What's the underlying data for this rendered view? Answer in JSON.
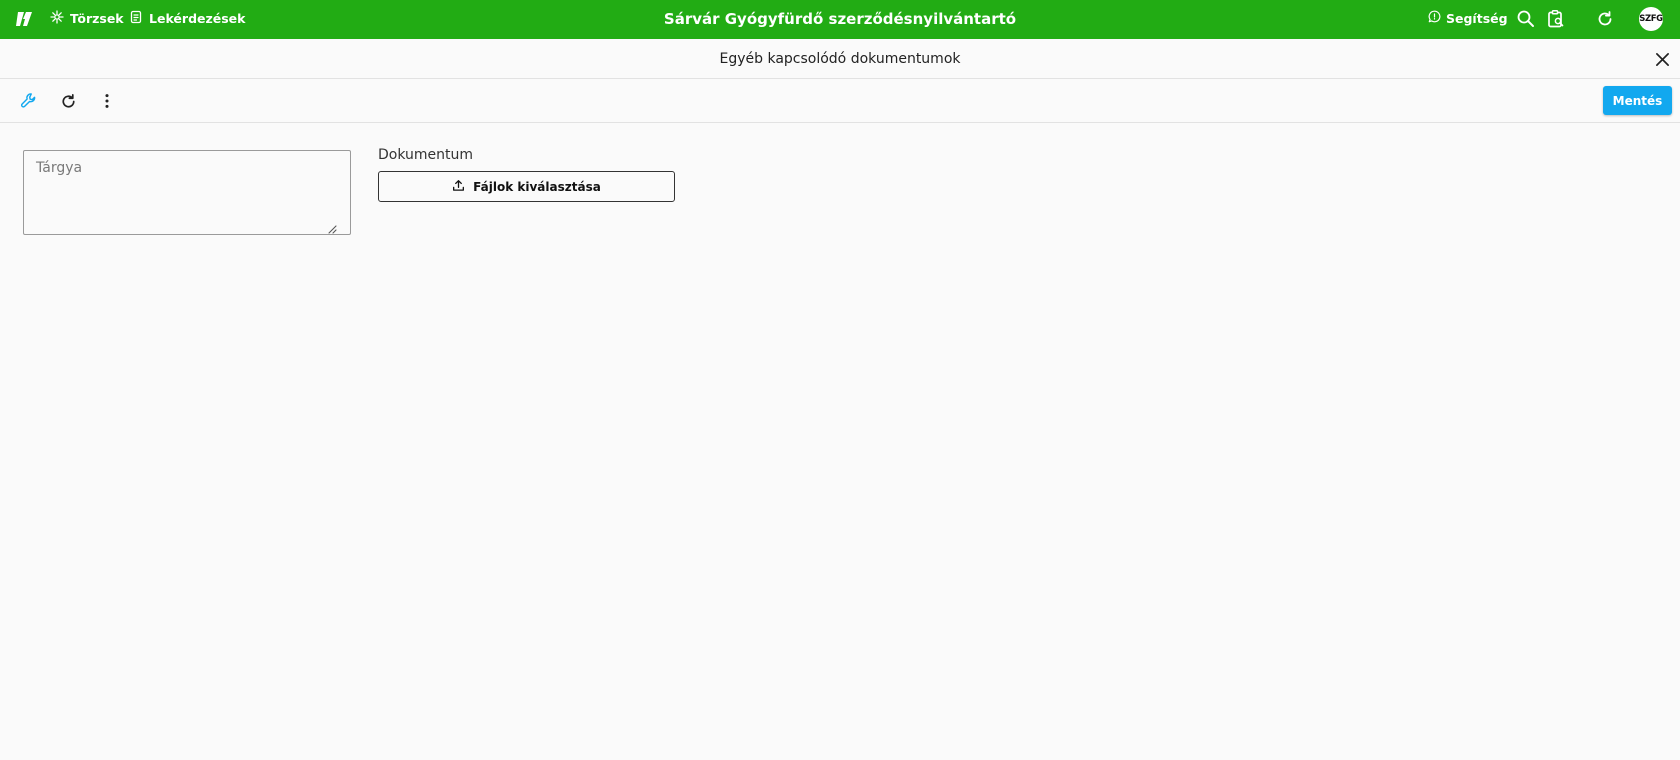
{
  "appbar": {
    "brand_color": "#22ac14",
    "logo_icon": "brand-logo-icon",
    "nav": [
      {
        "label": "Törzsek",
        "icon": "settings-cog-icon"
      },
      {
        "label": "Lekérdezések",
        "icon": "report-document-icon"
      }
    ],
    "title": "Sárvár Gyógyfürdő szerződésnyilvántartó",
    "help_label": "Segítség",
    "help_icon": "help-chat-icon",
    "actions": [
      "search-icon",
      "clipboard-search-icon",
      "refresh-icon"
    ],
    "avatar_initials": "SZFG"
  },
  "dialog": {
    "title": "Egyéb kapcsolódó dokumentumok",
    "close_icon": "close-icon"
  },
  "toolbar": {
    "icons": [
      "wrench-icon",
      "refresh-icon",
      "more-vertical-icon"
    ],
    "accent_color": "#12a8ef",
    "save_label": "Mentés"
  },
  "form": {
    "subject_placeholder": "Tárgya",
    "subject_value": "",
    "document_label": "Dokumentum",
    "file_button_label": "Fájlok kiválasztása",
    "file_button_icon": "upload-icon"
  }
}
